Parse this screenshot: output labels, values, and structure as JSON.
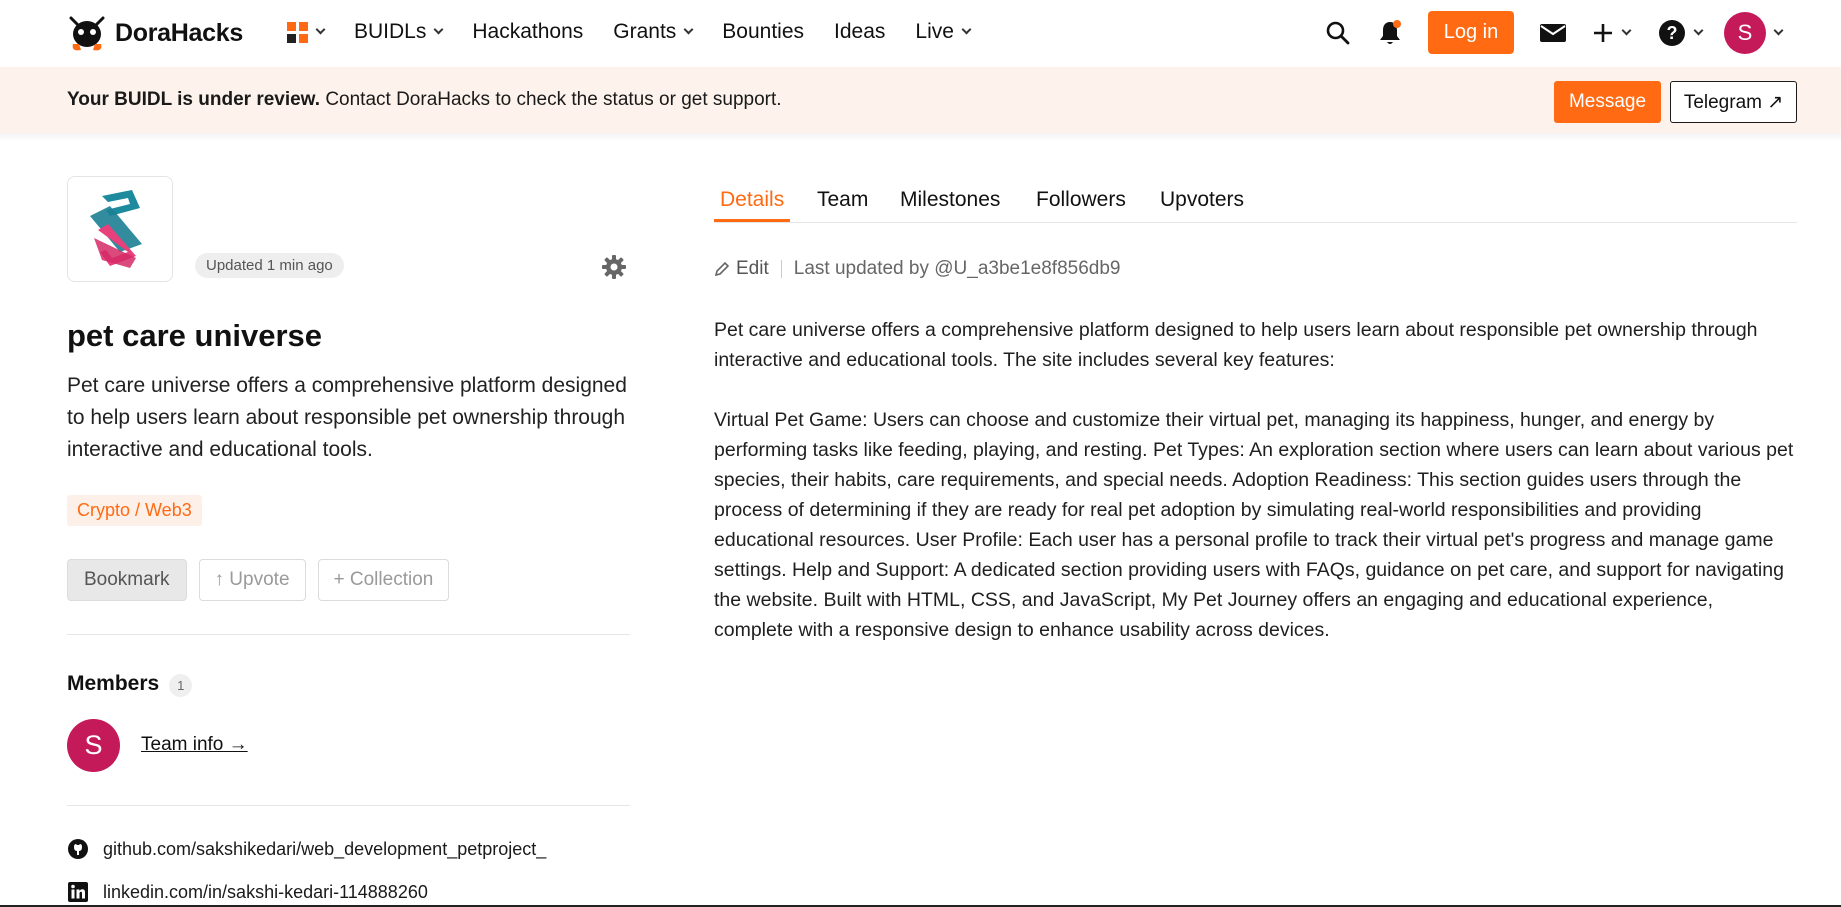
{
  "header": {
    "brand": "DoraHacks",
    "nav": [
      {
        "label": "BUIDLs",
        "dropdown": true
      },
      {
        "label": "Hackathons",
        "dropdown": false
      },
      {
        "label": "Grants",
        "dropdown": true
      },
      {
        "label": "Bounties",
        "dropdown": false
      },
      {
        "label": "Ideas",
        "dropdown": false
      },
      {
        "label": "Live",
        "dropdown": true
      }
    ],
    "login_label": "Log in",
    "avatar_letter": "S",
    "accent_color": "#ff6a13"
  },
  "banner": {
    "bold_text": "Your BUIDL is under review.",
    "text": " Contact DoraHacks to check the status or get support.",
    "message_label": "Message",
    "telegram_label": "Telegram ↗"
  },
  "project": {
    "updated": "Updated 1 min ago",
    "title": "pet care universe",
    "summary": "Pet care universe offers a comprehensive platform designed to help users learn about responsible pet ownership through interactive and educational tools.",
    "tag": "Crypto / Web3",
    "bookmark_label": "Bookmark",
    "upvote_label": "↑ Upvote",
    "collection_label": "+ Collection"
  },
  "members": {
    "heading": "Members",
    "count": "1",
    "avatar_letter": "S",
    "team_link": "Team info →"
  },
  "links": {
    "github": "github.com/sakshikedari/web_development_petproject_",
    "linkedin": "linkedin.com/in/sakshi-kedari-114888260"
  },
  "tabs": [
    "Details",
    "Team",
    "Milestones",
    "Followers",
    "Upvoters"
  ],
  "details": {
    "edit_label": "Edit",
    "last_updated": "Last updated by @U_a3be1e8f856db9",
    "paragraphs": [
      "Pet care universe offers a comprehensive platform designed to help users learn about responsible pet ownership through interactive and educational tools. The site includes several key features:",
      "Virtual Pet Game: Users can choose and customize their virtual pet, managing its happiness, hunger, and energy by performing tasks like feeding, playing, and resting. Pet Types: An exploration section where users can learn about various pet species, their habits, care requirements, and special needs. Adoption Readiness: This section guides users through the process of determining if they are ready for real pet adoption by simulating real-world responsibilities and providing educational resources. User Profile: Each user has a personal profile to track their virtual pet's progress and manage game settings. Help and Support: A dedicated section providing users with FAQs, guidance on pet care, and support for navigating the website. Built with HTML, CSS, and JavaScript, My Pet Journey offers an engaging and educational experience, complete with a responsive design to enhance usability across devices."
    ]
  }
}
